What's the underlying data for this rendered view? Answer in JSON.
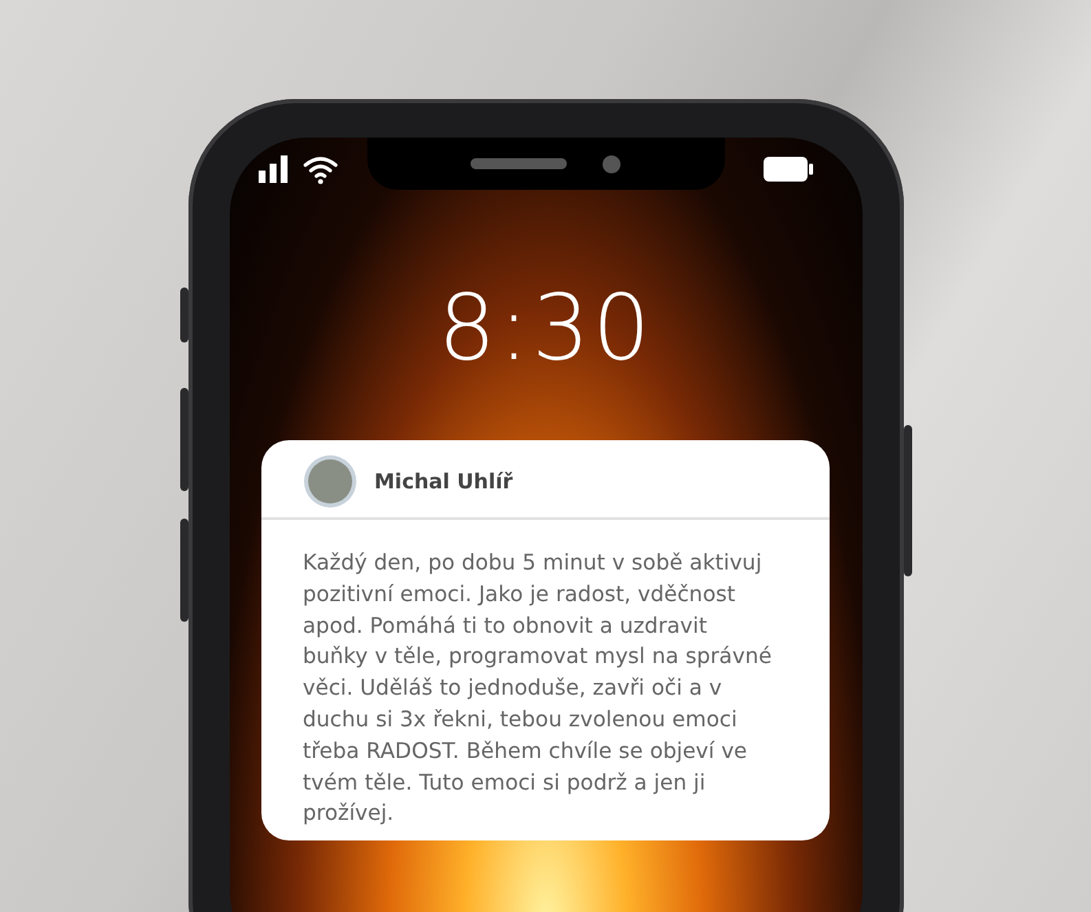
{
  "lock_screen": {
    "time": "8:30"
  },
  "notification": {
    "sender": "Michal Uhlíř",
    "message": "Každý den, po dobu 5 minut v sobě aktivuj pozitivní emoci. Jako je radost, vděčnost apod. Pomáhá ti to obnovit a uzdravit buňky v těle, programovat mysl na správné věci. Uděláš to jednoduše, zavři oči a v duchu si 3x řekni, tebou zvolenou emoci třeba RADOST. Během chvíle se objeví ve tvém těle. Tuto emoci si podrž a jen ji prožívej."
  }
}
